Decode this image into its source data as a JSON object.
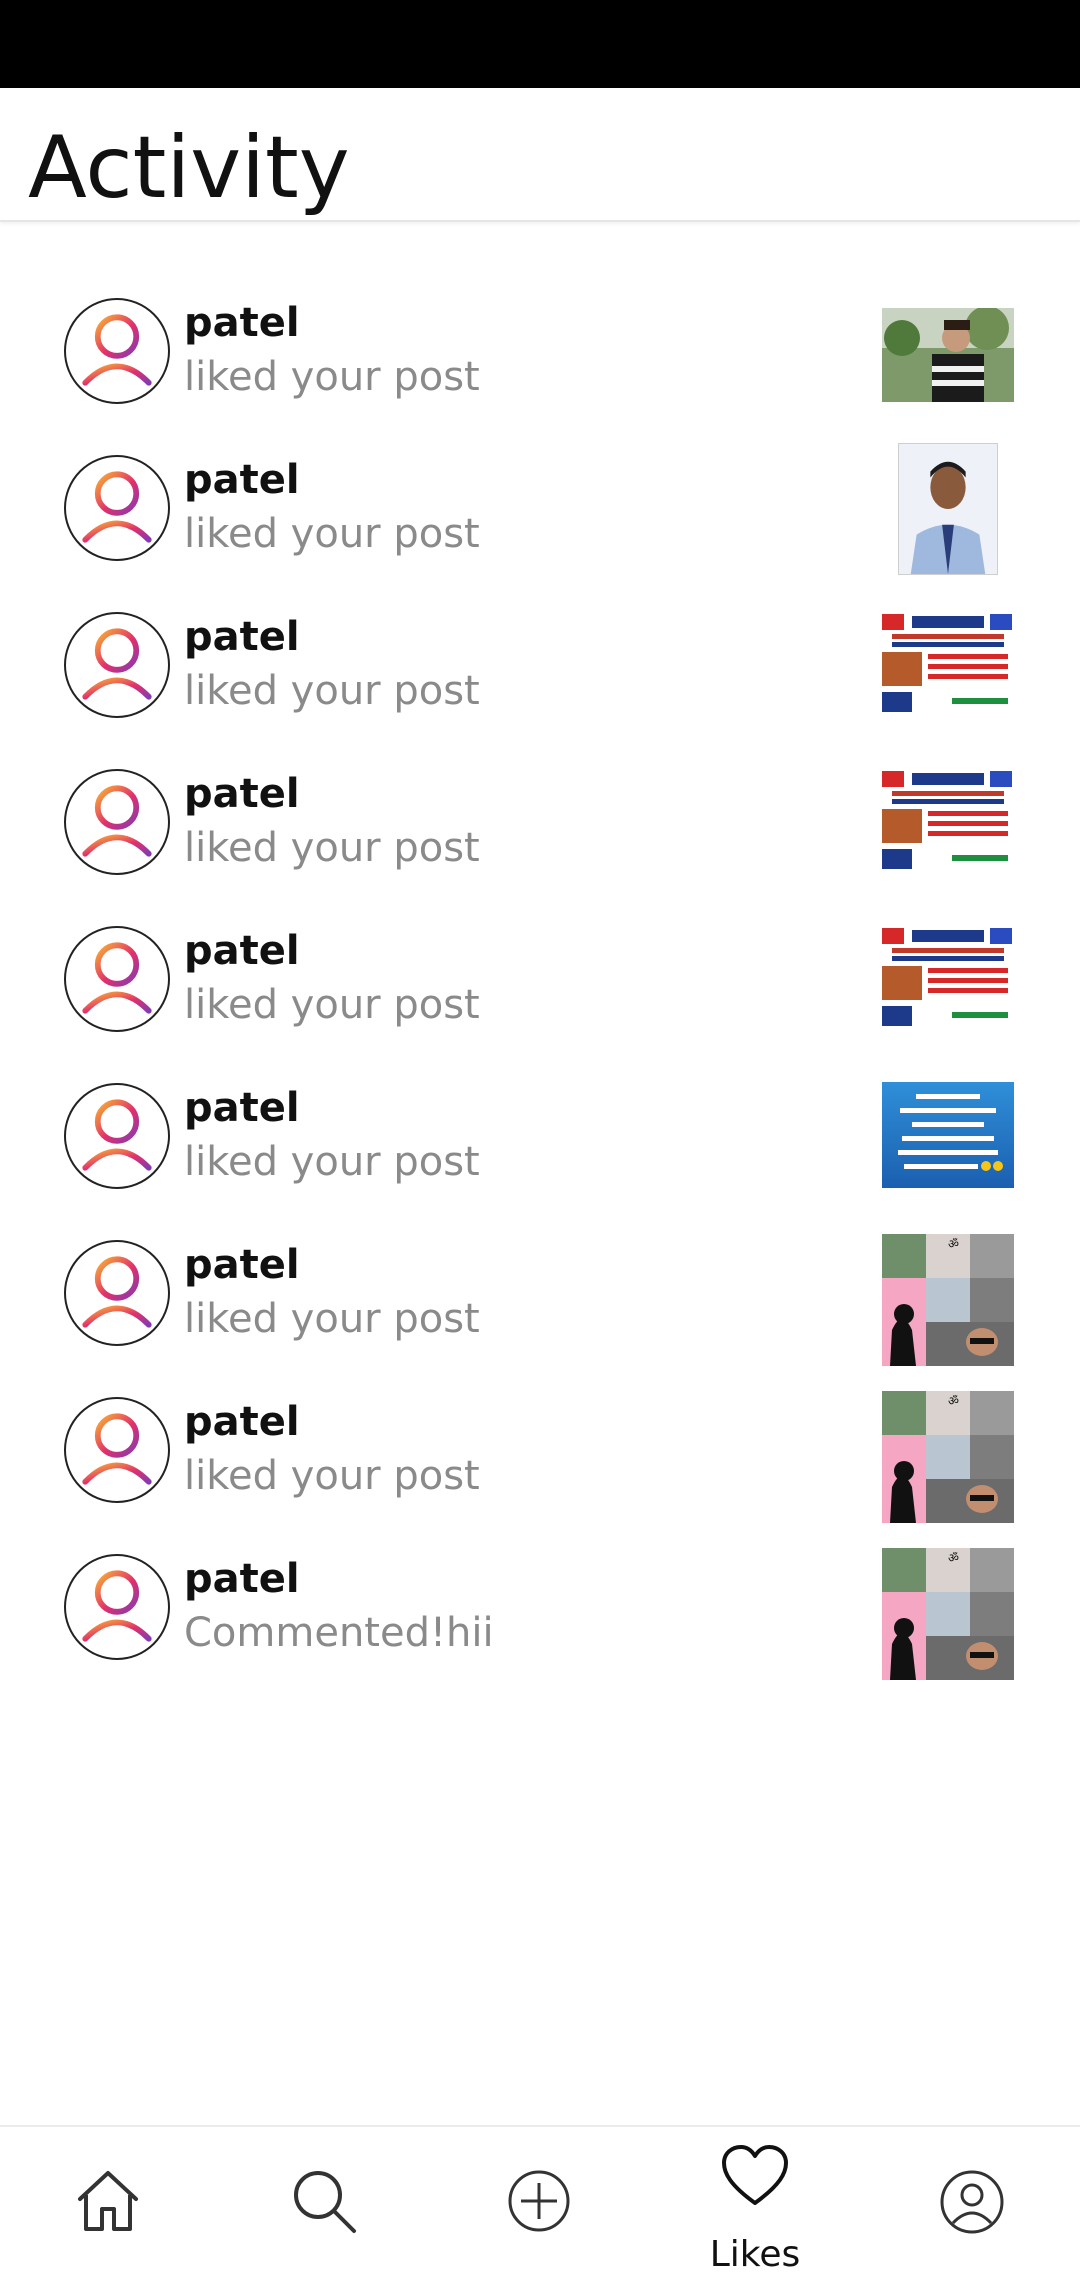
{
  "header": {
    "title": "Activity"
  },
  "activities": [
    {
      "username": "patel",
      "action": "liked your post",
      "thumb": "photo-man-stripes"
    },
    {
      "username": "patel",
      "action": "liked your post",
      "thumb": "photo-portrait"
    },
    {
      "username": "patel",
      "action": "liked your post",
      "thumb": "news-poster"
    },
    {
      "username": "patel",
      "action": "liked your post",
      "thumb": "news-poster"
    },
    {
      "username": "patel",
      "action": "liked your post",
      "thumb": "news-poster"
    },
    {
      "username": "patel",
      "action": "liked your post",
      "thumb": "blue-text-post"
    },
    {
      "username": "patel",
      "action": "liked your post",
      "thumb": "collage"
    },
    {
      "username": "patel",
      "action": "liked your post",
      "thumb": "collage"
    },
    {
      "username": "patel",
      "action": "Commented!hii",
      "thumb": "collage"
    }
  ],
  "nav": {
    "home_icon": "home-icon",
    "search_icon": "search-icon",
    "add_icon": "add-post-icon",
    "likes_icon": "heart-icon",
    "likes_label": "Likes",
    "profile_icon": "profile-icon"
  },
  "colors": {
    "avatar_gradient": [
      "#f9b233",
      "#e1306c",
      "#833ab4"
    ],
    "status_bar": "#000000",
    "secondary_text": "#8a8a8a"
  }
}
